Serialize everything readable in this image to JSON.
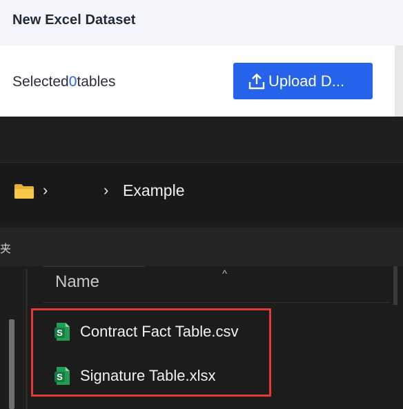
{
  "header": {
    "title": "New Excel Dataset"
  },
  "selection": {
    "prefix": "Selected",
    "count": "0",
    "suffix": "tables"
  },
  "toolbar": {
    "upload_label": "Upload D..."
  },
  "explorer": {
    "breadcrumb": {
      "current_folder": "Example"
    },
    "columns": {
      "name": "Name"
    },
    "files": [
      {
        "name": "Contract Fact Table.csv",
        "icon": "spreadsheet-icon"
      },
      {
        "name": "Signature Table.xlsx",
        "icon": "spreadsheet-icon"
      }
    ]
  },
  "colors": {
    "accent": "#2563eb",
    "highlight": "#e53935",
    "file_icon": "#21a366"
  }
}
